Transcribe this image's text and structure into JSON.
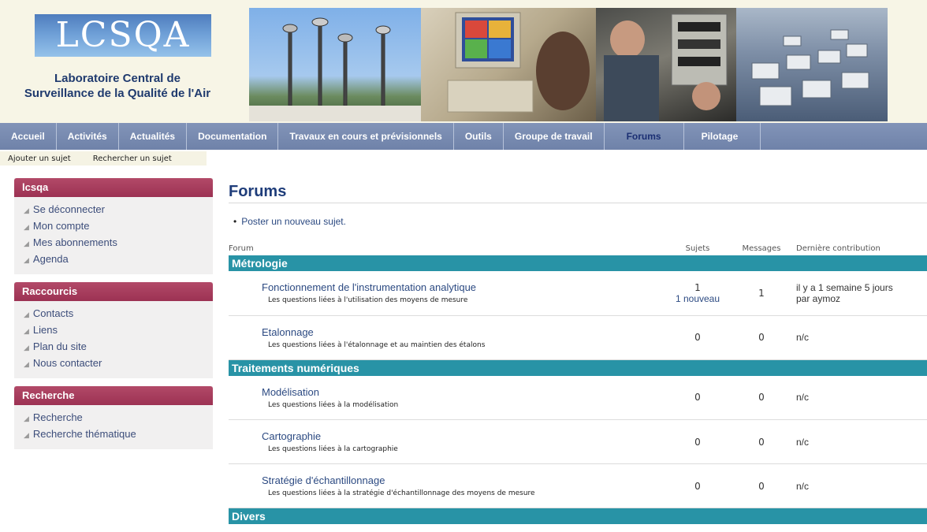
{
  "header": {
    "logo_text": "LCSQA",
    "org_name_line1": "Laboratoire Central de",
    "org_name_line2": "Surveillance de la Qualité de l'Air"
  },
  "nav": [
    {
      "label": "Accueil",
      "active": false
    },
    {
      "label": "Activités",
      "active": false
    },
    {
      "label": "Actualités",
      "active": false
    },
    {
      "label": "Documentation",
      "active": false
    },
    {
      "label": "Travaux en cours et prévisionnels",
      "active": false
    },
    {
      "label": "Outils",
      "active": false
    },
    {
      "label": "Groupe de travail",
      "active": false
    },
    {
      "label": "Forums",
      "active": true
    },
    {
      "label": "Pilotage",
      "active": false
    }
  ],
  "subnav": [
    "Ajouter un sujet",
    "Rechercher un sujet"
  ],
  "sidebar": {
    "boxes": [
      {
        "title": "lcsqa",
        "items": [
          "Se déconnecter",
          "Mon compte",
          "Mes abonnements",
          "Agenda"
        ]
      },
      {
        "title": "Raccourcis",
        "items": [
          "Contacts",
          "Liens",
          "Plan du site",
          "Nous contacter"
        ]
      },
      {
        "title": "Recherche",
        "items": [
          "Recherche",
          "Recherche thématique"
        ]
      }
    ]
  },
  "main": {
    "title": "Forums",
    "post_link": "Poster un nouveau sujet.",
    "columns": {
      "forum": "Forum",
      "sujets": "Sujets",
      "messages": "Messages",
      "last": "Dernière contribution"
    },
    "categories": [
      {
        "name": "Métrologie",
        "forums": [
          {
            "name": "Fonctionnement de l'instrumentation analytique",
            "desc": "Les questions liées à l'utilisation des moyens de mesure",
            "sujets": "1",
            "nouveau": "1 nouveau",
            "messages": "1",
            "last_line1": "il y a 1 semaine 5 jours",
            "last_line2": "par aymoz"
          },
          {
            "name": "Etalonnage",
            "desc": "Les questions liées à l'étalonnage et au maintien des étalons",
            "sujets": "0",
            "nouveau": "",
            "messages": "0",
            "last_line1": "n/c",
            "last_line2": ""
          }
        ]
      },
      {
        "name": "Traitements numériques",
        "forums": [
          {
            "name": "Modélisation",
            "desc": "Les questions liées à la modélisation",
            "sujets": "0",
            "nouveau": "",
            "messages": "0",
            "last_line1": "n/c",
            "last_line2": ""
          },
          {
            "name": "Cartographie",
            "desc": "Les questions liées à la cartographie",
            "sujets": "0",
            "nouveau": "",
            "messages": "0",
            "last_line1": "n/c",
            "last_line2": ""
          },
          {
            "name": "Stratégie d'échantillonnage",
            "desc": "Les questions liées à la stratégie d'échantillonnage des moyens de mesure",
            "sujets": "0",
            "nouveau": "",
            "messages": "0",
            "last_line1": "n/c",
            "last_line2": ""
          }
        ]
      },
      {
        "name": "Divers",
        "forums": []
      }
    ]
  }
}
